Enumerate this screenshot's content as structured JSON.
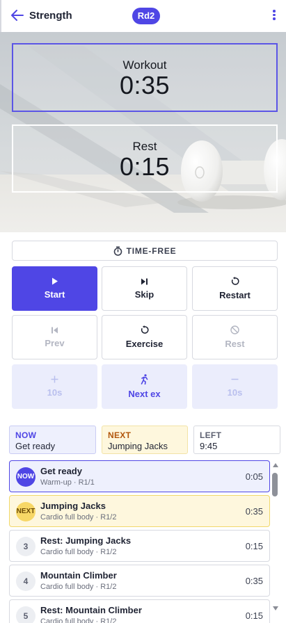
{
  "header": {
    "title": "Strength",
    "round_badge": "Rd2"
  },
  "timers": {
    "workout": {
      "label": "Workout",
      "value": "0:35"
    },
    "rest": {
      "label": "Rest",
      "value": "0:15"
    }
  },
  "mode_button": {
    "label": "TIME-FREE",
    "icon": "stopwatch-icon"
  },
  "controls": {
    "start": {
      "label": "Start",
      "icon": "play-icon"
    },
    "skip": {
      "label": "Skip",
      "icon": "skip-next-icon"
    },
    "restart": {
      "label": "Restart",
      "icon": "restart-icon"
    },
    "prev": {
      "label": "Prev",
      "icon": "skip-previous-icon",
      "disabled": true
    },
    "exercise": {
      "label": "Exercise",
      "icon": "restart-icon"
    },
    "rest": {
      "label": "Rest",
      "icon": "block-icon",
      "disabled": true
    },
    "plus10": {
      "label": "10s",
      "icon": "plus-icon",
      "disabled": true
    },
    "next_ex": {
      "label": "Next ex",
      "icon": "runner-icon"
    },
    "minus10": {
      "label": "10s",
      "icon": "minus-icon",
      "disabled": true
    }
  },
  "status": {
    "now": {
      "caption": "NOW",
      "value": "Get ready"
    },
    "next": {
      "caption": "NEXT",
      "value": "Jumping Jacks"
    },
    "left": {
      "caption": "LEFT",
      "value": "9:45"
    }
  },
  "exercises": [
    {
      "badge": "NOW",
      "name": "Get ready",
      "sub": "Warm-up · R1/1",
      "duration": "0:05",
      "state": "active"
    },
    {
      "badge": "NEXT",
      "name": "Jumping Jacks",
      "sub": "Cardio full body · R1/2",
      "duration": "0:35",
      "state": "upnext"
    },
    {
      "badge": "3",
      "name": "Rest: Jumping Jacks",
      "sub": "Cardio full body · R1/2",
      "duration": "0:15",
      "state": "normal"
    },
    {
      "badge": "4",
      "name": "Mountain Climber",
      "sub": "Cardio full body · R1/2",
      "duration": "0:35",
      "state": "normal"
    },
    {
      "badge": "5",
      "name": "Rest: Mountain Climber",
      "sub": "Cardio full body · R1/2",
      "duration": "0:15",
      "state": "normal"
    }
  ],
  "colors": {
    "accent": "#4f46e5",
    "next_accent": "#f1d86a",
    "next_text": "#b2560c"
  }
}
